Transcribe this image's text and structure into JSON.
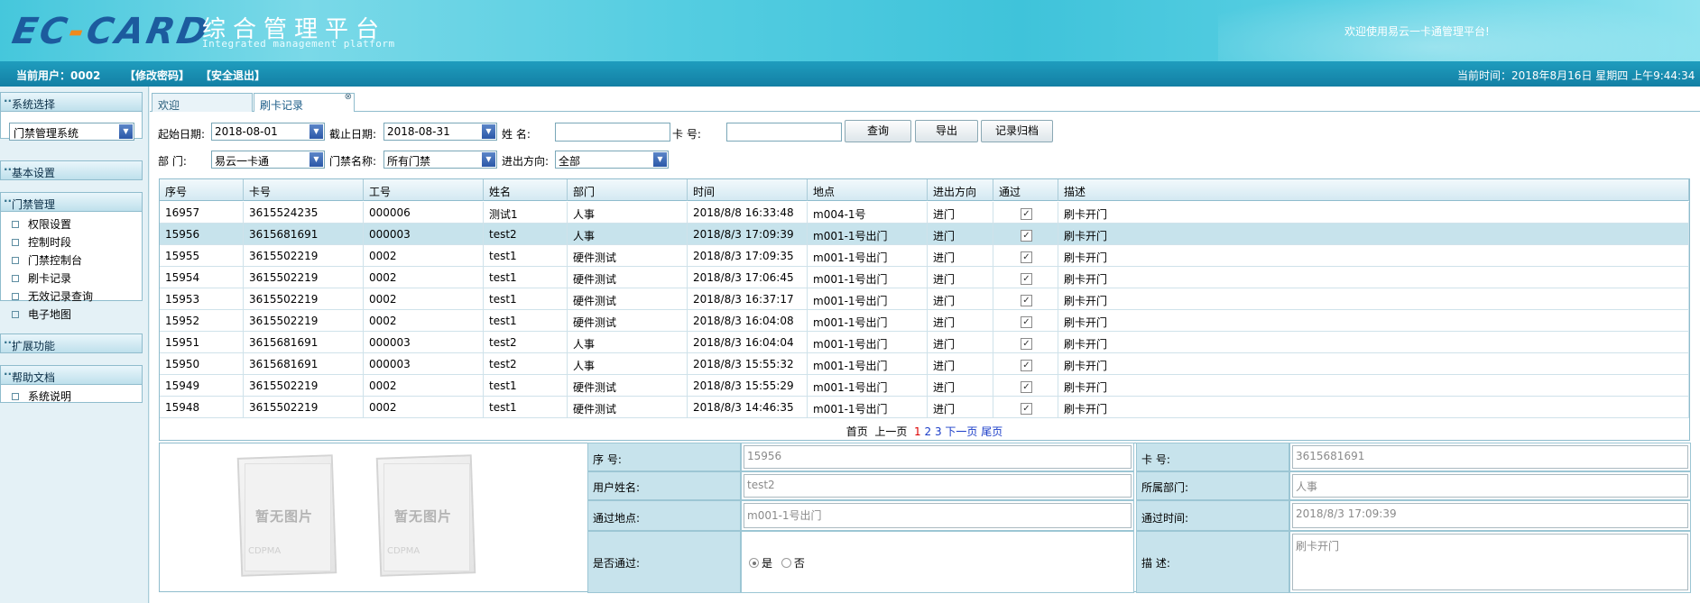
{
  "banner": {
    "logo_left": "EC",
    "logo_dash": "-",
    "logo_right": "CARD",
    "title_cn": "综合管理平台",
    "title_en": "Integrated management platform",
    "welcome": "欢迎使用易云一卡通管理平台!"
  },
  "topbar": {
    "current_user": "当前用户：0002",
    "change_password": "【修改密码】",
    "logout": "【安全退出】",
    "time": "当前时间：2018年8月16日 星期四 上午9:44:34"
  },
  "sidebar": {
    "system_select_title": "系统选择",
    "system_select_value": "门禁管理系统",
    "basic_settings": "基本设置",
    "access_title": "门禁管理",
    "access_items": [
      "权限设置",
      "控制时段",
      "门禁控制台",
      "刷卡记录",
      "无效记录查询",
      "电子地图"
    ],
    "extensions": "扩展功能",
    "help_title": "帮助文档",
    "help_items": [
      "系统说明"
    ]
  },
  "tabs": {
    "welcome": "欢迎",
    "active": "刷卡记录",
    "close_glyph": "⊗"
  },
  "filters": {
    "start_date_label": "起始日期:",
    "start_date": "2018-08-01",
    "end_date_label": "截止日期:",
    "end_date": "2018-08-31",
    "name_label": "姓 名:",
    "name_value": "",
    "card_label": "卡 号:",
    "card_value": "",
    "dept_label": "部 门:",
    "dept_value": "易云一卡通",
    "door_label": "门禁名称:",
    "door_value": "所有门禁",
    "direction_label": "进出方向:",
    "direction_value": "全部",
    "query_btn": "查询",
    "export_btn": "导出",
    "archive_btn": "记录归档"
  },
  "table": {
    "headers": [
      "序号",
      "卡号",
      "工号",
      "姓名",
      "部门",
      "时间",
      "地点",
      "进出方向",
      "通过",
      "描述"
    ],
    "check_glyph": "✓",
    "rows": [
      [
        "16957",
        "3615524235",
        "000006",
        "测试1",
        "人事",
        "2018/8/8 16:33:48",
        "m004-1号",
        "进门",
        "",
        "刷卡开门"
      ],
      [
        "15956",
        "3615681691",
        "000003",
        "test2",
        "人事",
        "2018/8/3 17:09:39",
        "m001-1号出门",
        "进门",
        "",
        "刷卡开门"
      ],
      [
        "15955",
        "3615502219",
        "0002",
        "test1",
        "硬件测试",
        "2018/8/3 17:09:35",
        "m001-1号出门",
        "进门",
        "",
        "刷卡开门"
      ],
      [
        "15954",
        "3615502219",
        "0002",
        "test1",
        "硬件测试",
        "2018/8/3 17:06:45",
        "m001-1号出门",
        "进门",
        "",
        "刷卡开门"
      ],
      [
        "15953",
        "3615502219",
        "0002",
        "test1",
        "硬件测试",
        "2018/8/3 16:37:17",
        "m001-1号出门",
        "进门",
        "",
        "刷卡开门"
      ],
      [
        "15952",
        "3615502219",
        "0002",
        "test1",
        "硬件测试",
        "2018/8/3 16:04:08",
        "m001-1号出门",
        "进门",
        "",
        "刷卡开门"
      ],
      [
        "15951",
        "3615681691",
        "000003",
        "test2",
        "人事",
        "2018/8/3 16:04:04",
        "m001-1号出门",
        "进门",
        "",
        "刷卡开门"
      ],
      [
        "15950",
        "3615681691",
        "000003",
        "test2",
        "人事",
        "2018/8/3 15:55:32",
        "m001-1号出门",
        "进门",
        "",
        "刷卡开门"
      ],
      [
        "15949",
        "3615502219",
        "0002",
        "test1",
        "硬件测试",
        "2018/8/3 15:55:29",
        "m001-1号出门",
        "进门",
        "",
        "刷卡开门"
      ],
      [
        "15948",
        "3615502219",
        "0002",
        "test1",
        "硬件测试",
        "2018/8/3 14:46:35",
        "m001-1号出门",
        "进门",
        "",
        "刷卡开门"
      ]
    ]
  },
  "pager": {
    "first": "首页",
    "prev": "上一页",
    "pages": [
      "1",
      "2",
      "3"
    ],
    "next": "下一页",
    "last": "尾页"
  },
  "detail": {
    "photo_text": "暂无图片",
    "photo_watermark": "CDPMA",
    "seq_label": "序 号:",
    "seq_value": "15956",
    "card_label": "卡 号:",
    "card_value": "3615681691",
    "user_label": "用户姓名:",
    "user_value": "test2",
    "dept_label": "所属部门:",
    "dept_value": "人事",
    "place_label": "通过地点:",
    "place_value": "m001-1号出门",
    "time_label": "通过时间:",
    "time_value": "2018/8/3 17:09:39",
    "pass_label": "是否通过:",
    "pass_yes": "是",
    "pass_no": "否",
    "desc_label": "描 述:",
    "desc_value": "刷卡开门"
  }
}
